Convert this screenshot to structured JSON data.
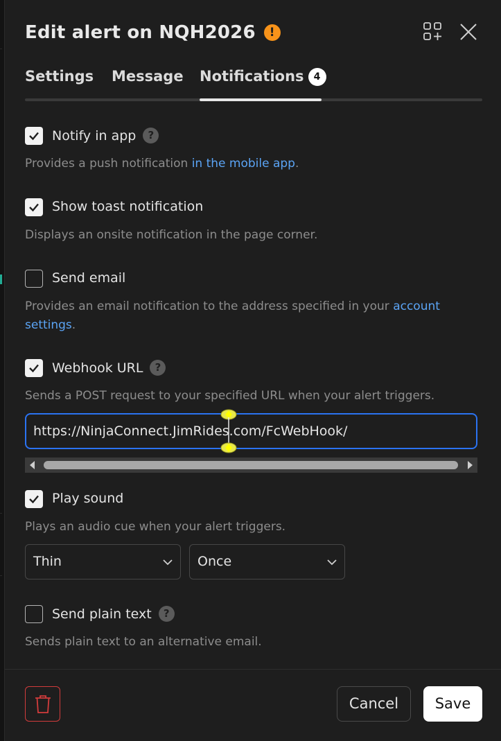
{
  "header": {
    "title": "Edit alert on NQH2026",
    "warning_glyph": "!",
    "icons": {
      "warning": "warning-icon",
      "add_widget": "add-widget-icon",
      "close": "close-icon"
    }
  },
  "tabs": [
    {
      "label": "Settings"
    },
    {
      "label": "Message"
    },
    {
      "label": "Notifications",
      "badge": "4",
      "active": true
    }
  ],
  "help_glyph": "?",
  "notify_app": {
    "label": "Notify in app",
    "checked": true,
    "desc_before": "Provides a push notification ",
    "desc_link": "in the mobile app",
    "desc_after": "."
  },
  "toast": {
    "label": "Show toast notification",
    "checked": true,
    "desc": "Displays an onsite notification in the page corner."
  },
  "email": {
    "label": "Send email",
    "checked": false,
    "desc_before": "Provides an email notification to the address specified in your ",
    "desc_link": "account settings",
    "desc_after": "."
  },
  "webhook": {
    "label": "Webhook URL",
    "checked": true,
    "desc": "Sends a POST request to your specified URL when your alert triggers.",
    "url": "https://NinjaConnect.JimRides.com/FcWebHook/"
  },
  "sound": {
    "label": "Play sound",
    "checked": true,
    "desc": "Plays an audio cue when your alert triggers.",
    "sound_select": "Thin",
    "repeat_select": "Once"
  },
  "plain_text": {
    "label": "Send plain text",
    "checked": false,
    "desc": "Sends plain text to an alternative email."
  },
  "footer": {
    "cancel": "Cancel",
    "save": "Save",
    "delete_icon": "trash-icon"
  },
  "colors": {
    "accent_blue": "#2b73f2",
    "link_blue": "#5ba4f5",
    "warning_orange": "#f7931a",
    "danger_red": "#d23c3c",
    "panel_bg": "#1e1e1e"
  }
}
